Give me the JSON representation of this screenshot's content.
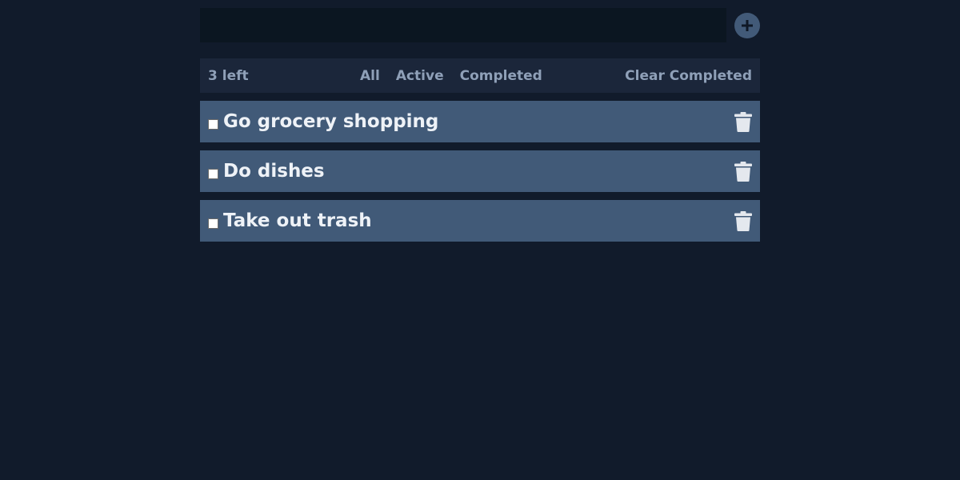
{
  "new_todo": {
    "value": "",
    "placeholder": ""
  },
  "add_button": {
    "icon": "plus-icon"
  },
  "toolbar": {
    "count_label": "3 left",
    "filters": [
      {
        "label": "All"
      },
      {
        "label": "Active"
      },
      {
        "label": "Completed"
      }
    ],
    "clear_label": "Clear Completed"
  },
  "todos": [
    {
      "text": "Go grocery shopping",
      "completed": false,
      "delete_icon": "trash-icon"
    },
    {
      "text": "Do dishes",
      "completed": false,
      "delete_icon": "trash-icon"
    },
    {
      "text": "Take out trash",
      "completed": false,
      "delete_icon": "trash-icon"
    }
  ],
  "colors": {
    "background": "#111b2b",
    "input_bg": "#0b1621",
    "toolbar_bg": "#1b263a",
    "toolbar_text": "#8fa0b8",
    "item_bg": "#415a78",
    "item_text": "#eef2f7",
    "add_button_bg": "#425a78"
  }
}
